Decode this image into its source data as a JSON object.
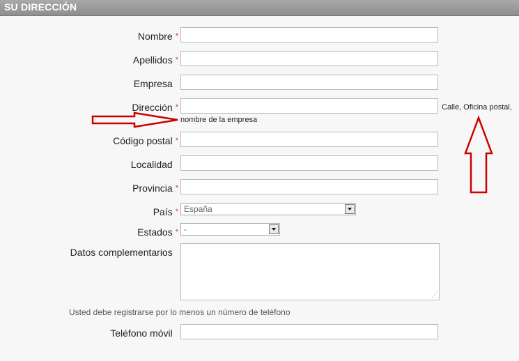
{
  "header": {
    "title": "SU DIRECCIÓN"
  },
  "fields": {
    "nombre": {
      "label": "Nombre",
      "required": "*",
      "value": ""
    },
    "apellidos": {
      "label": "Apellidos",
      "required": "*",
      "value": ""
    },
    "empresa": {
      "label": "Empresa",
      "required": "",
      "value": ""
    },
    "direccion": {
      "label": "Dirección",
      "required": "*",
      "value": "",
      "hint_right": "Calle, Oficina postal,",
      "hint_below": "nombre de la empresa"
    },
    "codigo_postal": {
      "label": "Código postal",
      "required": "*",
      "value": ""
    },
    "localidad": {
      "label": "Localidad",
      "required": "",
      "value": ""
    },
    "provincia": {
      "label": "Provincia",
      "required": "*",
      "value": ""
    },
    "pais": {
      "label": "País",
      "required": "*",
      "selected": "España"
    },
    "estados": {
      "label": "Estados",
      "required": "*",
      "selected": "-"
    },
    "datos": {
      "label": "Datos complementarios",
      "required": "",
      "value": ""
    },
    "telefono_movil": {
      "label": "Teléfono móvil",
      "required": "",
      "value": ""
    }
  },
  "phone_note": "Usted debe registrarse por lo menos un número de teléfono",
  "colors": {
    "required": "#cc3333",
    "arrow": "#cc0000",
    "header": "#999999"
  },
  "icons": {
    "arrows": "red-arrow-icon"
  }
}
